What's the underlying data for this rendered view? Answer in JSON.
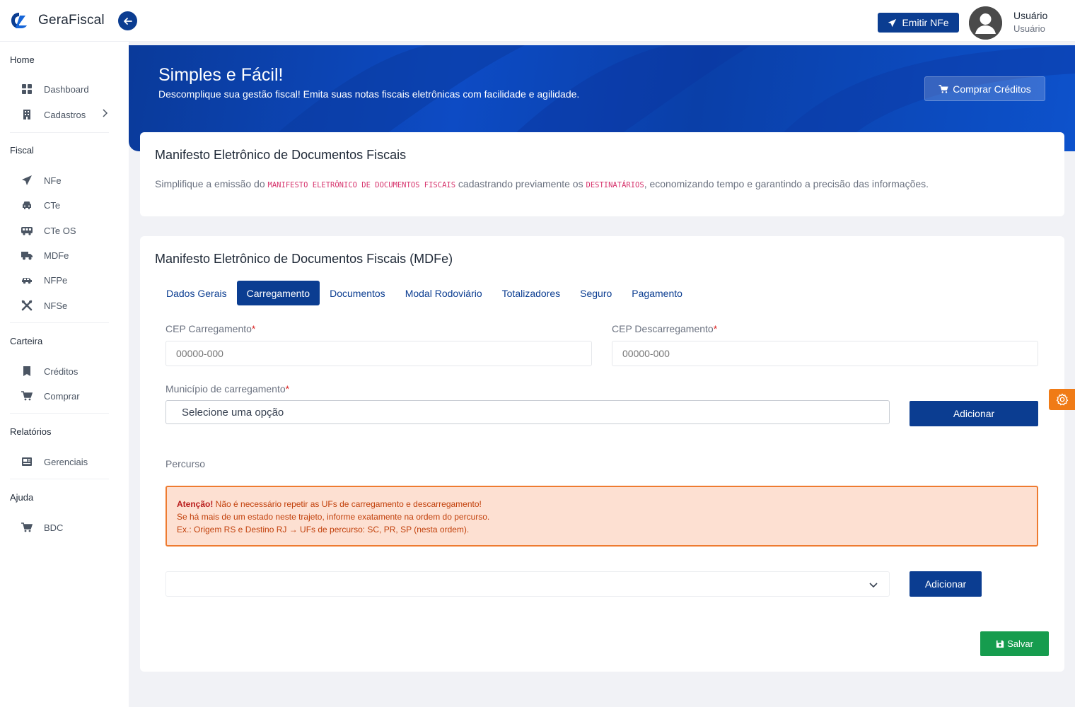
{
  "header": {
    "brand": "GeraFiscal",
    "emit_label": "Emitir NFe",
    "user_name": "Usuário",
    "user_role": "Usuário"
  },
  "sidebar": {
    "sections": [
      {
        "title": "Home",
        "items": [
          {
            "label": "Dashboard",
            "icon": "dashboard-icon"
          },
          {
            "label": "Cadastros",
            "icon": "building-icon"
          }
        ]
      },
      {
        "title": "Fiscal",
        "items": [
          {
            "label": "NFe",
            "icon": "paper-plane-icon"
          },
          {
            "label": "CTe",
            "icon": "car-icon"
          },
          {
            "label": "CTe OS",
            "icon": "bus-icon"
          },
          {
            "label": "MDFe",
            "icon": "truck-icon"
          },
          {
            "label": "NFPe",
            "icon": "car-side-icon"
          },
          {
            "label": "NFSe",
            "icon": "tools-icon"
          }
        ]
      },
      {
        "title": "Carteira",
        "items": [
          {
            "label": "Créditos",
            "icon": "bookmark-icon"
          },
          {
            "label": "Comprar",
            "icon": "cart-icon"
          }
        ]
      },
      {
        "title": "Relatórios",
        "items": [
          {
            "label": "Gerenciais",
            "icon": "newspaper-icon"
          }
        ]
      },
      {
        "title": "Ajuda",
        "items": [
          {
            "label": "BDC",
            "icon": "cart-icon"
          }
        ]
      }
    ]
  },
  "banner": {
    "title": "Simples e Fácil!",
    "subtitle": "Descomplique sua gestão fiscal! Emita suas notas fiscais eletrônicas com facilidade e agilidade.",
    "buy_label": "Comprar Créditos"
  },
  "intro": {
    "title": "Manifesto Eletrônico de Documentos Fiscais",
    "desc_1": "Simplifique a emissão do ",
    "code_1": "MANIFESTO ELETRÔNICO DE DOCUMENTOS FISCAIS",
    "desc_2": " cadastrando previamente os ",
    "code_2": "DESTINATÁRIOS",
    "desc_3": ", economizando tempo e garantindo a precisão das informações."
  },
  "form": {
    "title": "Manifesto Eletrônico de Documentos Fiscais (MDFe)",
    "tabs": [
      "Dados Gerais",
      "Carregamento",
      "Documentos",
      "Modal Rodoviário",
      "Totalizadores",
      "Seguro",
      "Pagamento"
    ],
    "active_tab": "Carregamento",
    "cep_carregamento_label": "CEP Carregamento",
    "cep_carregamento_placeholder": "00000-000",
    "cep_descarregamento_label": "CEP Descarregamento",
    "cep_descarregamento_placeholder": "00000-000",
    "municipio_label": "Município de carregamento",
    "municipio_value": "Selecione uma opção",
    "add_label": "Adicionar",
    "percurso_label": "Percurso",
    "alert_strong": "Atenção!",
    "alert_line1": " Não é necessário repetir as UFs de carregamento e descarregamento!",
    "alert_line2": "Se há mais de um estado neste trajeto, informe exatamente na ordem do percurso.",
    "alert_line3": "Ex.: Origem RS e Destino RJ → UFs de percurso: SC, PR, SP (nesta ordem).",
    "add_label_2": "Adicionar",
    "save_label": "Salvar"
  },
  "colors": {
    "primary": "#0b3d91",
    "success": "#169c4e",
    "warning": "#ee7b30",
    "accent_orange": "#f07b16"
  }
}
